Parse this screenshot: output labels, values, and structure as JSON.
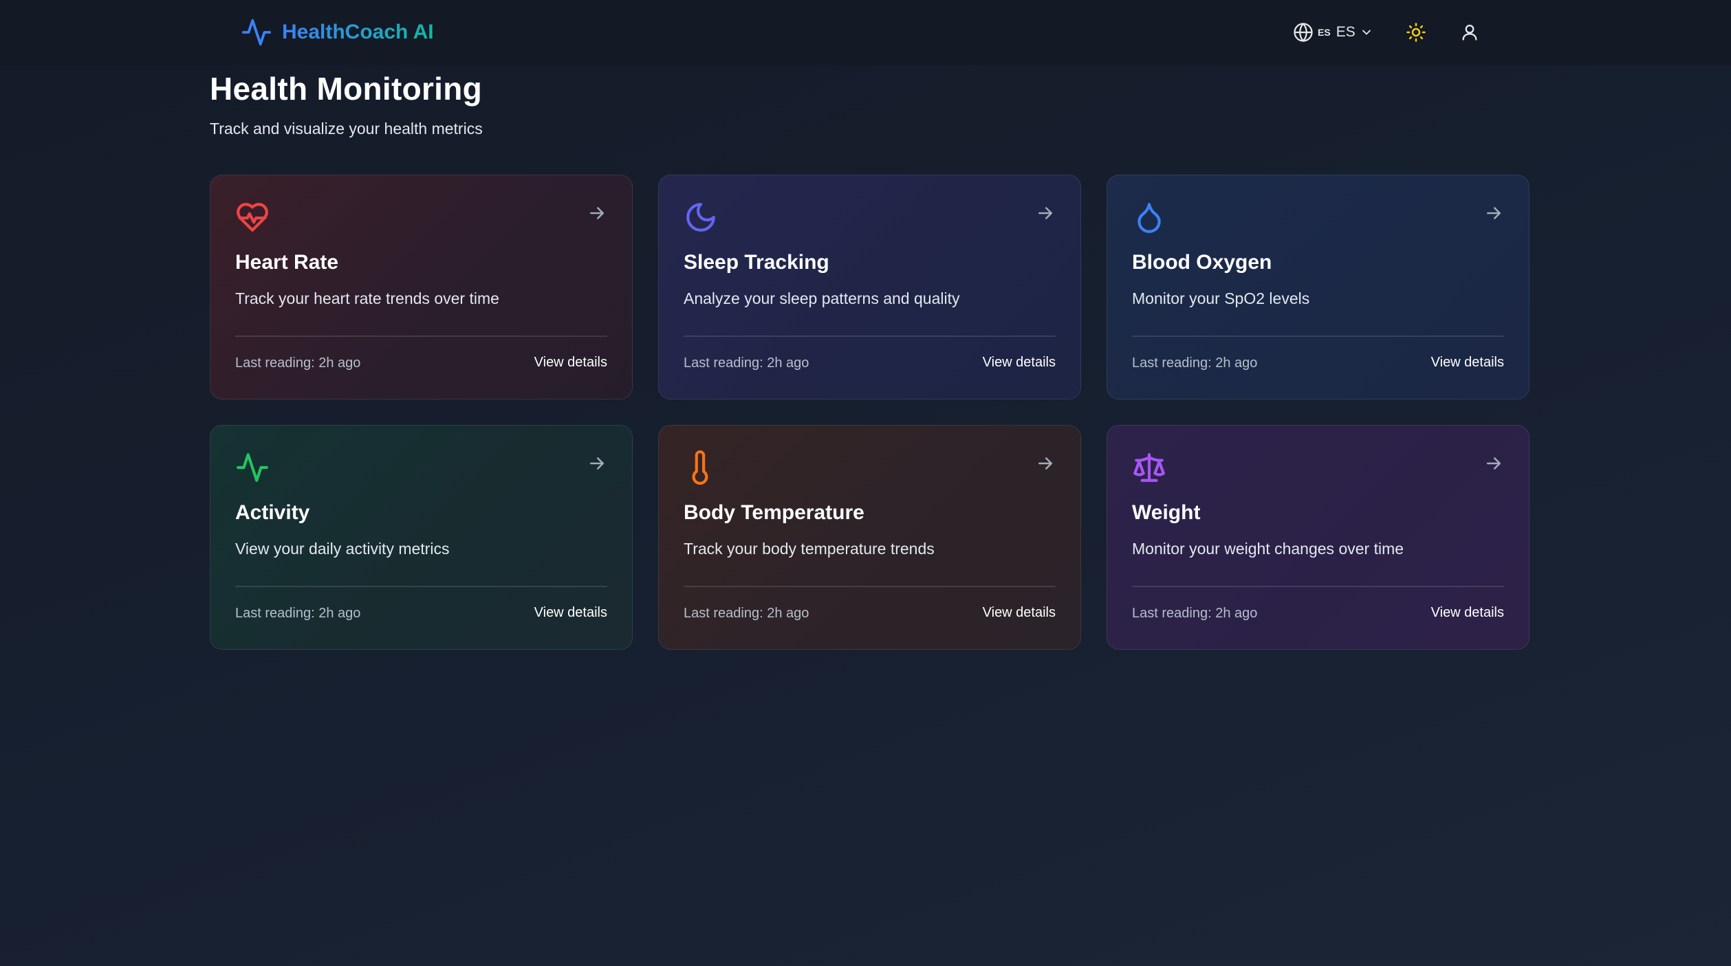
{
  "header": {
    "brand": "HealthCoach AI",
    "language_small": "ES",
    "language_label": "ES"
  },
  "page": {
    "title": "Health Monitoring",
    "subtitle": "Track and visualize your health metrics"
  },
  "cards": [
    {
      "title": "Heart Rate",
      "description": "Track your heart rate trends over time",
      "last_reading": "Last reading: 2h ago",
      "link": "View details",
      "icon": "heart-pulse-icon",
      "color": "#ef4444"
    },
    {
      "title": "Sleep Tracking",
      "description": "Analyze your sleep patterns and quality",
      "last_reading": "Last reading: 2h ago",
      "link": "View details",
      "icon": "moon-icon",
      "color": "#6366f1"
    },
    {
      "title": "Blood Oxygen",
      "description": "Monitor your SpO2 levels",
      "last_reading": "Last reading: 2h ago",
      "link": "View details",
      "icon": "droplet-icon",
      "color": "#3b82f6"
    },
    {
      "title": "Activity",
      "description": "View your daily activity metrics",
      "last_reading": "Last reading: 2h ago",
      "link": "View details",
      "icon": "activity-icon",
      "color": "#22c55e"
    },
    {
      "title": "Body Temperature",
      "description": "Track your body temperature trends",
      "last_reading": "Last reading: 2h ago",
      "link": "View details",
      "icon": "thermometer-icon",
      "color": "#f97316"
    },
    {
      "title": "Weight",
      "description": "Monitor your weight changes over time",
      "last_reading": "Last reading: 2h ago",
      "link": "View details",
      "icon": "scale-icon",
      "color": "#a855f7"
    }
  ],
  "colors": {
    "brand_gradient_start": "#3b82f6",
    "brand_gradient_end": "#14b8a6",
    "theme_icon": "#facc15"
  }
}
